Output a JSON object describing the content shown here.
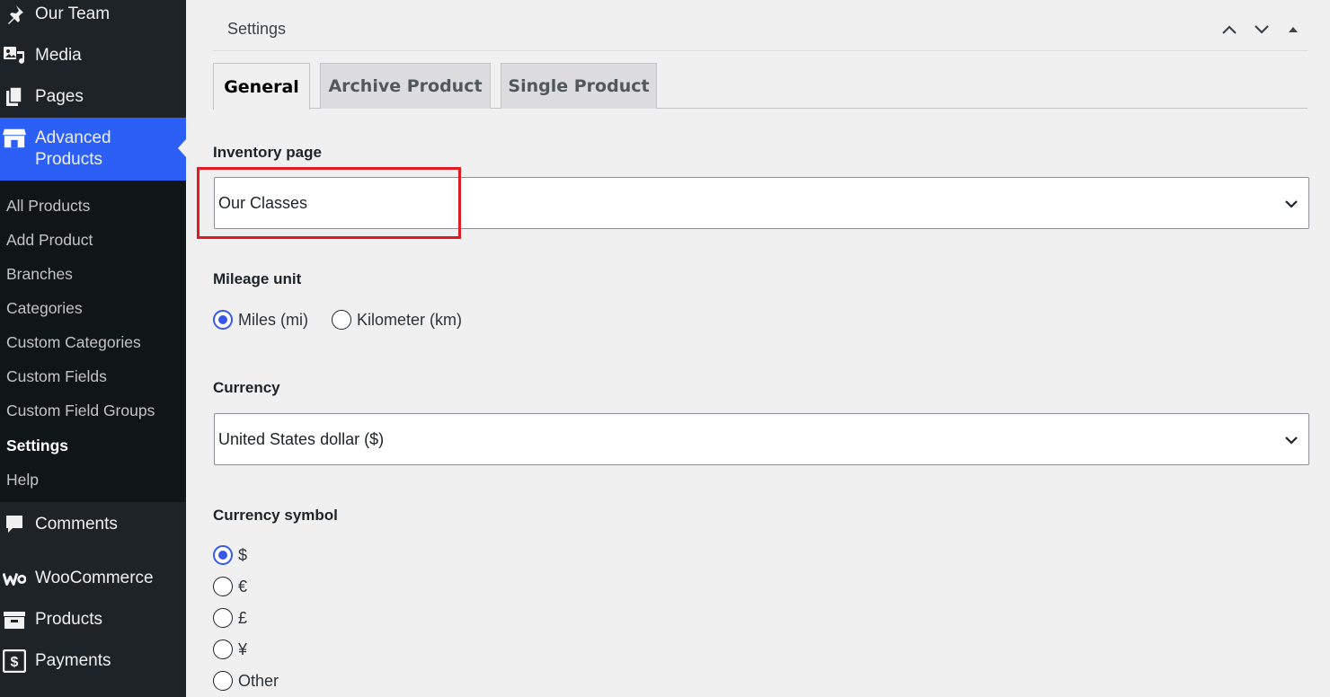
{
  "sidebar": {
    "menu": {
      "team": "Our Team",
      "media": "Media",
      "pages": "Pages",
      "advanced_line1": "Advanced",
      "advanced_line2": "Products",
      "comments": "Comments",
      "woocommerce": "WooCommerce",
      "products": "Products",
      "payments": "Payments"
    },
    "submenu": {
      "all_products": "All Products",
      "add_product": "Add Product",
      "branches": "Branches",
      "categories": "Categories",
      "custom_categories": "Custom Categories",
      "custom_fields": "Custom Fields",
      "custom_field_groups": "Custom Field Groups",
      "settings": "Settings",
      "help": "Help"
    }
  },
  "settings": {
    "title": "Settings",
    "tabs": {
      "general": "General",
      "archive": "Archive Product",
      "single": "Single Product"
    },
    "inventory_page": {
      "label": "Inventory page",
      "value": "Our Classes"
    },
    "mileage": {
      "label": "Mileage unit",
      "miles": "Miles (mi)",
      "km": "Kilometer (km)",
      "selected": "Miles (mi)"
    },
    "currency": {
      "label": "Currency",
      "value": "United States dollar ($)"
    },
    "currency_symbol": {
      "label": "Currency symbol",
      "usd": "$",
      "eur": "€",
      "gbp": "£",
      "jpy": "¥",
      "other": "Other",
      "selected": "$"
    }
  },
  "colors": {
    "accent": "#2c5ff6",
    "radio_selected": "#3858e9",
    "highlight": "#e01b24",
    "sidebar_bg": "#1d2327"
  }
}
